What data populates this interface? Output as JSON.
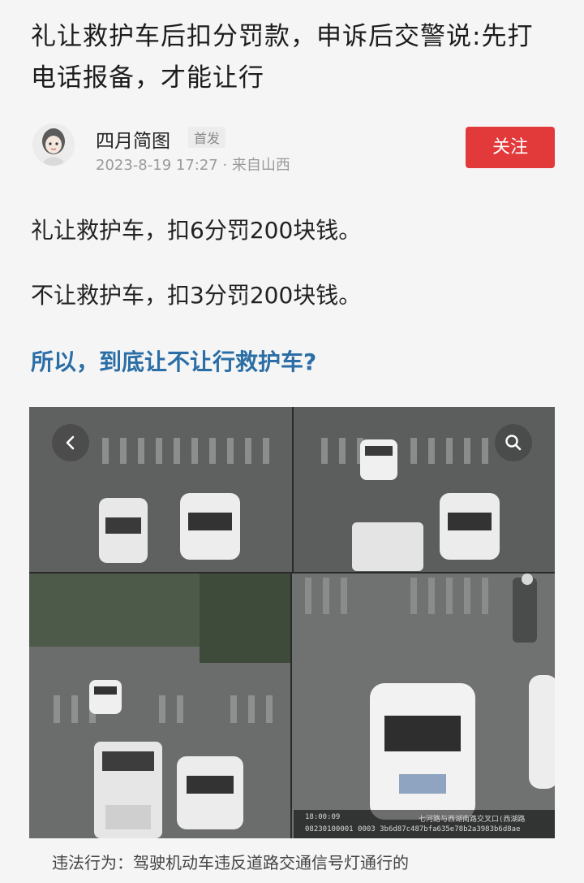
{
  "article": {
    "title": "礼让救护车后扣分罚款，申诉后交警说:先打电话报备，才能让行",
    "paragraph1": "礼让救护车，扣6分罚200块钱。",
    "paragraph2": "不让救护车，扣3分罚200块钱。",
    "question": "所以，到底让不让行救护车?"
  },
  "author": {
    "name": "四月简图",
    "badge": "首发",
    "meta": "2023-8-19 17:27 · 来自山西",
    "follow_label": "关注"
  },
  "photo": {
    "timestamp": "18:00:09",
    "location_text": "七河路与西湖南路交叉口(西湖路",
    "serial": "08230100001 0003 3b6d87c487bfa635e78b2a3983b6d8ae",
    "caption": "违法行为：驾驶机动车违反道路交通信号灯通行的"
  },
  "colors": {
    "follow_button": "#e23a3a",
    "question_text": "#2b6ea6"
  }
}
